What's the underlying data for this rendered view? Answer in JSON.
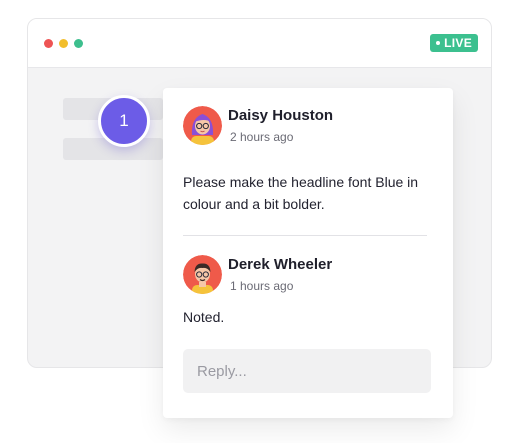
{
  "header": {
    "live_label": "LIVE"
  },
  "marker": {
    "number": "1"
  },
  "comments": [
    {
      "author": "Daisy Houston",
      "time": "2 hours ago",
      "text": "Please make the headline font Blue in colour and a bit bolder.",
      "avatar_icon": "woman-with-glasses-avatar"
    },
    {
      "author": "Derek Wheeler",
      "time": "1 hours ago",
      "text": "Noted.",
      "avatar_icon": "man-with-glasses-avatar"
    }
  ],
  "reply": {
    "placeholder": "Reply..."
  },
  "colors": {
    "accent": "#6c5ce7",
    "live": "#3cc08f",
    "dot_red": "#ee5454",
    "dot_yellow": "#f2be2c",
    "dot_green": "#3dbf8e"
  }
}
